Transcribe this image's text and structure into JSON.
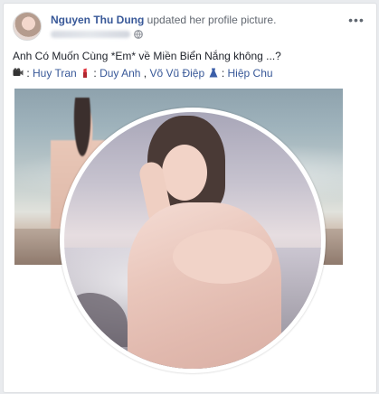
{
  "post": {
    "author_name": "Nguyen Thu Dung",
    "action_text": "updated her profile picture.",
    "caption": "Anh Có Muốn Cùng *Em* về Miền Biển Nắng không ...?",
    "credits": {
      "prefix": " : ",
      "person1": "Huy Tran",
      "sep1": " : ",
      "person2": "Duy Anh",
      "comma": " , ",
      "person3": "Võ Vũ Điệp",
      "sep2": " : ",
      "person4": "Hiệp Chu"
    },
    "more_label": "•••"
  },
  "icons": {
    "camera": "video-camera-icon",
    "lipstick": "lipstick-icon",
    "dress": "dress-icon",
    "globe": "globe-icon",
    "more": "more-options-icon"
  },
  "colors": {
    "link": "#385898",
    "text": "#1d2129",
    "meta": "#616770",
    "background": "#e9ebee",
    "card": "#ffffff"
  }
}
